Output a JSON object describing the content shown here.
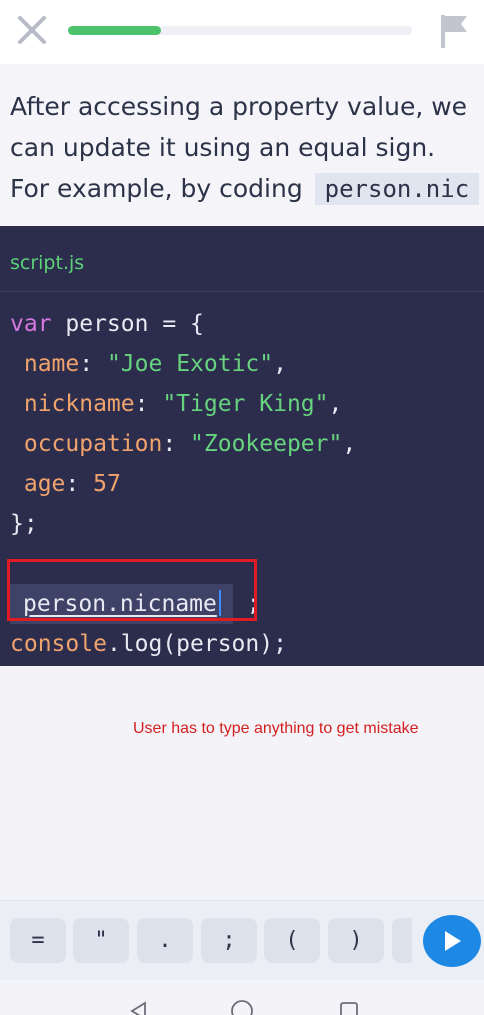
{
  "progress_fraction": 0.27,
  "lesson": {
    "line1": "After accessing a property value, we",
    "line2": "can update it using an equal sign.",
    "line3_prefix": "For example, by coding",
    "inline_code": "person.nic"
  },
  "editor": {
    "filename": "script.js",
    "code": {
      "l1_kw": "var",
      "l1_rest": " person = {",
      "l2_key": " name",
      "l2_colon": ": ",
      "l2_val": "\"Joe Exotic\"",
      "l2_end": ",",
      "l3_key": " nickname",
      "l3_colon": ": ",
      "l3_val": "\"Tiger King\"",
      "l3_end": ",",
      "l4_key": " occupation",
      "l4_colon": ": ",
      "l4_val": "\"Zookeeper\"",
      "l4_end": ",",
      "l5_key": " age",
      "l5_colon": ": ",
      "l5_val": "57",
      "l6": "};",
      "input_value": "person.nicname",
      "input_end": " ;",
      "l9_fn": "console",
      "l9_rest": ".log(person);"
    }
  },
  "annotation": "User has to type anything to get mistake",
  "keybar": {
    "keys": [
      "=",
      "\"",
      ".",
      ";",
      "(",
      ")"
    ]
  },
  "icons": {
    "close": "close-icon",
    "flag": "flag-icon",
    "run": "play-icon",
    "back": "back-triangle-icon",
    "home": "home-circle-icon",
    "recents": "recents-square-icon"
  },
  "colors": {
    "progress": "#4cc36b",
    "editor_bg": "#2c2d4d",
    "filename": "#5dd27b",
    "keyword": "#d778e0",
    "string": "#67d37e",
    "property": "#f0a36d",
    "run_button": "#1e88e5",
    "annotation": "#d52020"
  }
}
